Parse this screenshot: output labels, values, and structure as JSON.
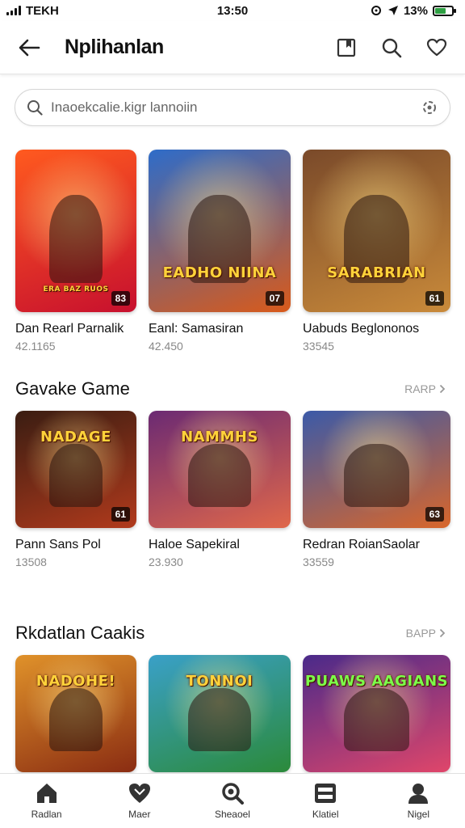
{
  "status": {
    "carrier": "TEKH",
    "time": "13:50",
    "battery": "13%"
  },
  "header": {
    "title": "Nplihanlan"
  },
  "search": {
    "placeholder": "Inaoekcalie.kigr lannoiin"
  },
  "sections": [
    {
      "title": "",
      "see_all": ""
    },
    {
      "title": "Gavake Game",
      "see_all": "RARP"
    },
    {
      "title": "Rkdatlan Caakis",
      "see_all": "BAPP"
    }
  ],
  "rows": [
    [
      {
        "title": "Dan Rearl Parnalik",
        "count": "42.1165",
        "badge": "83",
        "banner": "ERA BAZ RUOS",
        "colors": [
          "#ff5a1f",
          "#c7102e"
        ]
      },
      {
        "title": "Eanl: Samasiran",
        "count": "42.450",
        "badge": "07",
        "banner": "EADHO NIINA",
        "colors": [
          "#2e6cc9",
          "#d95a1a"
        ]
      },
      {
        "title": "Uabuds Beglononos",
        "count": "33545",
        "badge": "61",
        "banner": "SARABRIAN",
        "colors": [
          "#7a4a2a",
          "#c98a3a"
        ]
      }
    ],
    [
      {
        "title": "Pann Sans Pol",
        "count": "13508",
        "badge": "61",
        "banner": "NADAGE",
        "colors": [
          "#3a1d12",
          "#b13a1c"
        ]
      },
      {
        "title": "Haloe Sapekiral",
        "count": "23.930",
        "badge": "",
        "banner": "NAMMHS",
        "colors": [
          "#6b2a73",
          "#e0674a"
        ]
      },
      {
        "title": "Redran RoianSaolar",
        "count": "33559",
        "badge": "63",
        "banner": "",
        "colors": [
          "#3b5aa8",
          "#d9662a"
        ]
      }
    ],
    [
      {
        "title": "",
        "count": "",
        "badge": "",
        "banner": "NADOHE!",
        "colors": [
          "#e0922a",
          "#8a2c12"
        ]
      },
      {
        "title": "",
        "count": "",
        "badge": "",
        "banner": "TONNOI",
        "colors": [
          "#3aa0c8",
          "#2b8a3a"
        ]
      },
      {
        "title": "",
        "count": "",
        "badge": "",
        "banner": "PUAWS AAGIANS",
        "colors": [
          "#4a2a8a",
          "#e0466a"
        ]
      }
    ]
  ],
  "nav": [
    {
      "label": "Radlan",
      "icon": "home-icon"
    },
    {
      "label": "Maer",
      "icon": "heart-icon"
    },
    {
      "label": "Sheaoel",
      "icon": "search-icon"
    },
    {
      "label": "Klatiel",
      "icon": "library-icon"
    },
    {
      "label": "Nigel",
      "icon": "profile-icon"
    }
  ]
}
